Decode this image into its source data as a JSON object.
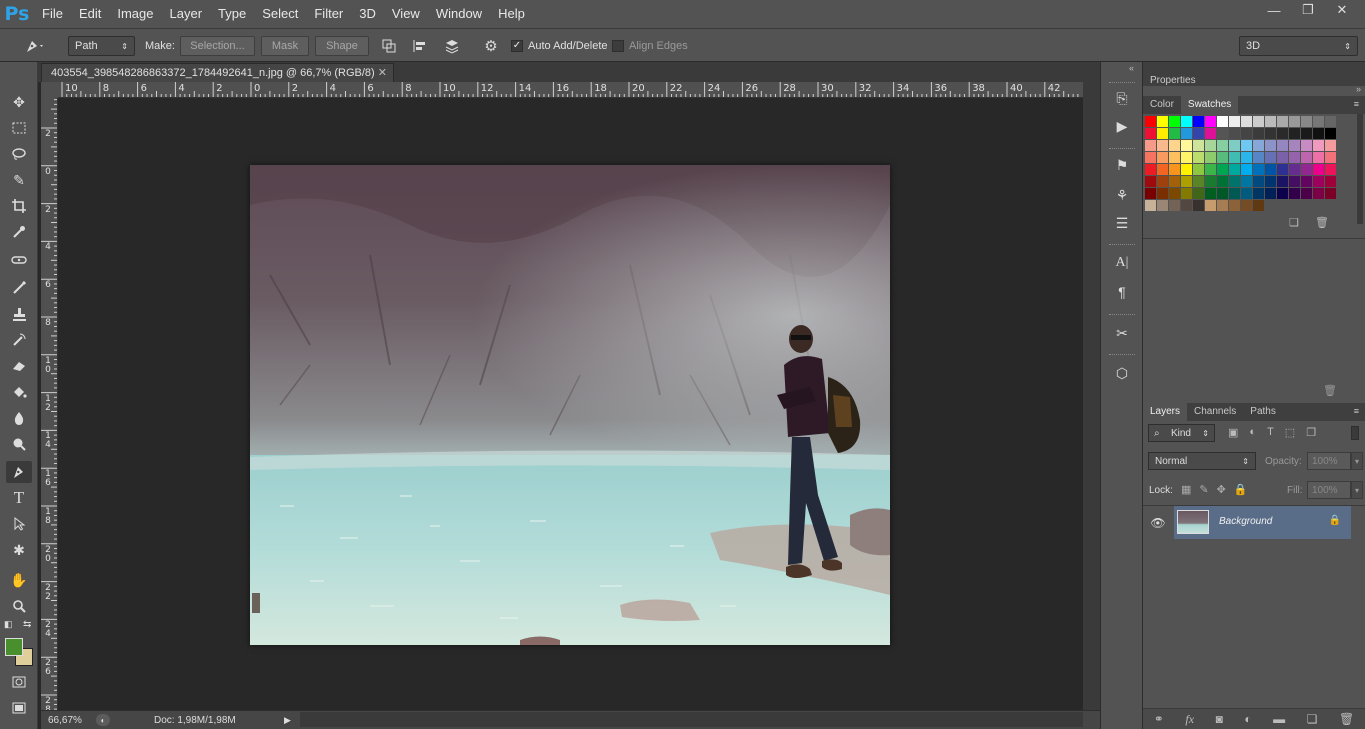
{
  "app": {
    "logo": "Ps"
  },
  "menu": [
    "File",
    "Edit",
    "Image",
    "Layer",
    "Type",
    "Select",
    "Filter",
    "3D",
    "View",
    "Window",
    "Help"
  ],
  "window_controls": {
    "minimize": "—",
    "restore": "❐",
    "close": "✕"
  },
  "options": {
    "mode_value": "Path",
    "make_label": "Make:",
    "selection_btn": "Selection...",
    "mask_btn": "Mask",
    "shape_btn": "Shape",
    "auto_add_delete_label": "Auto Add/Delete",
    "auto_add_delete_checked": true,
    "align_edges_label": "Align Edges",
    "align_edges_checked": false,
    "workspace_value": "3D"
  },
  "document": {
    "tab_title": "403554_398548286863372_1784492641_n.jpg @ 66,7% (RGB/8)",
    "close_glyph": "✕",
    "zoom": "66,67%",
    "doc_info": "Doc: 1,98M/1,98M"
  },
  "ruler_top_labels": [
    "10",
    "8",
    "6",
    "4",
    "2",
    "0",
    "2",
    "4",
    "6",
    "8",
    "10",
    "12",
    "14",
    "16",
    "18",
    "20",
    "22",
    "24",
    "26",
    "28",
    "30",
    "32",
    "34",
    "36",
    "38",
    "40",
    "42"
  ],
  "ruler_left_labels": [
    "2",
    "0",
    "2",
    "4",
    "6",
    "8",
    "10",
    "12",
    "14",
    "16",
    "18",
    "20",
    "22",
    "24",
    "26",
    "28"
  ],
  "panels": {
    "properties_tab": "Properties",
    "color_tab": "Color",
    "swatches_tab": "Swatches",
    "layers_tab": "Layers",
    "channels_tab": "Channels",
    "paths_tab": "Paths",
    "filter_kind": "Kind",
    "blend_mode": "Normal",
    "opacity_label": "Opacity:",
    "opacity_value": "100%",
    "lock_label": "Lock:",
    "fill_label": "Fill:",
    "fill_value": "100%",
    "layer_name": "Background"
  },
  "colors": {
    "foreground": "#4a8f2e",
    "background": "#e0cf9b",
    "accent_logo": "#2fa3e6",
    "selected_layer": "#596d88"
  },
  "swatch_rows": [
    [
      "#ff0000",
      "#ffff00",
      "#00ff00",
      "#00ffff",
      "#0000ff",
      "#ff00ff",
      "#ffffff",
      "#eeeeee",
      "#dddddd",
      "#cccccc",
      "#bbbbbb",
      "#aaaaaa",
      "#999999",
      "#888888",
      "#777777",
      "#666666"
    ],
    [
      "#ee1133",
      "#ffee00",
      "#22bb44",
      "#2299dd",
      "#3344aa",
      "#dd1199",
      "#555555",
      "#4d4d4d",
      "#444444",
      "#3b3b3b",
      "#333333",
      "#2a2a2a",
      "#222222",
      "#1a1a1a",
      "#111111",
      "#000000"
    ],
    [
      "#f79a8a",
      "#f9b98c",
      "#fcd48c",
      "#fff89a",
      "#cde49a",
      "#a6d69a",
      "#86cfa0",
      "#7dcdc4",
      "#6fc8ef",
      "#85a8d8",
      "#8b93c9",
      "#9486c0",
      "#a685bf",
      "#c88bc3",
      "#f19ac0",
      "#f59a9d"
    ],
    [
      "#f5735f",
      "#f89b5f",
      "#fcc15e",
      "#fff56b",
      "#bcdc6d",
      "#8dcb6d",
      "#58bd7c",
      "#3fbdb0",
      "#2ab6ea",
      "#5686c6",
      "#6570b5",
      "#7a61aa",
      "#9463ab",
      "#bd66ae",
      "#ef6fa8",
      "#f2717a"
    ],
    [
      "#ed1c24",
      "#f26522",
      "#f7941d",
      "#fff200",
      "#8dc63f",
      "#39b54a",
      "#00a651",
      "#00a99d",
      "#00aeef",
      "#0072bc",
      "#0054a6",
      "#2e3192",
      "#662d91",
      "#92278f",
      "#ec008c",
      "#ed145b"
    ],
    [
      "#9e0b0f",
      "#a0410d",
      "#a36209",
      "#aba000",
      "#598527",
      "#197b30",
      "#007236",
      "#00746b",
      "#0076a3",
      "#004a80",
      "#003471",
      "#1b1464",
      "#440e62",
      "#630460",
      "#9e005d",
      "#9e0039"
    ],
    [
      "#790000",
      "#7b2e00",
      "#7d4900",
      "#827b00",
      "#406618",
      "#005e20",
      "#005826",
      "#005952",
      "#005b7f",
      "#003663",
      "#002157",
      "#0d004c",
      "#32004b",
      "#4b0049",
      "#7b0046",
      "#7a0026"
    ],
    [
      "#c7b299",
      "#998675",
      "#736357",
      "#534741",
      "#37302d",
      "#c69c6d",
      "#a67c52",
      "#8c6239",
      "#754c24",
      "#603913"
    ]
  ]
}
